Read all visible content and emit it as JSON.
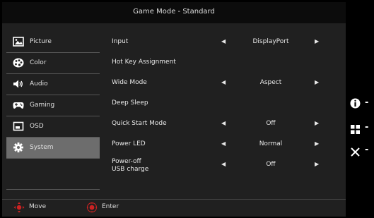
{
  "header": {
    "title": "Game Mode - Standard"
  },
  "sidebar": {
    "items": [
      {
        "label": "Picture",
        "icon": "picture-icon",
        "selected": false
      },
      {
        "label": "Color",
        "icon": "palette-icon",
        "selected": false
      },
      {
        "label": "Audio",
        "icon": "speaker-icon",
        "selected": false
      },
      {
        "label": "Gaming",
        "icon": "gamepad-icon",
        "selected": false
      },
      {
        "label": "OSD",
        "icon": "osd-icon",
        "selected": false
      },
      {
        "label": "System",
        "icon": "gear-icon",
        "selected": true
      }
    ]
  },
  "menu": {
    "rows": [
      {
        "name": "Input",
        "value": "DisplayPort",
        "arrows": true
      },
      {
        "name": "Hot Key Assignment",
        "value": "",
        "arrows": false
      },
      {
        "name": "Wide Mode",
        "value": "Aspect",
        "arrows": true
      },
      {
        "name": "Deep Sleep",
        "value": "",
        "arrows": false
      },
      {
        "name": "Quick Start Mode",
        "value": "Off",
        "arrows": true
      },
      {
        "name": "Power LED",
        "value": "Normal",
        "arrows": true
      },
      {
        "name": "Power-off\nUSB charge",
        "value": "Off",
        "arrows": true
      }
    ],
    "arrow_left": "◀",
    "arrow_right": "▶"
  },
  "footer": {
    "move_label": "Move",
    "enter_label": "Enter"
  },
  "side_keys": [
    {
      "icon": "info-icon",
      "dash": "-"
    },
    {
      "icon": "grid-icon",
      "dash": "-"
    },
    {
      "icon": "close-icon",
      "dash": "-"
    }
  ],
  "colors": {
    "panel": "#202020",
    "titlebar": "#0c0c0c",
    "selected": "#6d6d6d",
    "joystick_red": "#cc2222"
  }
}
